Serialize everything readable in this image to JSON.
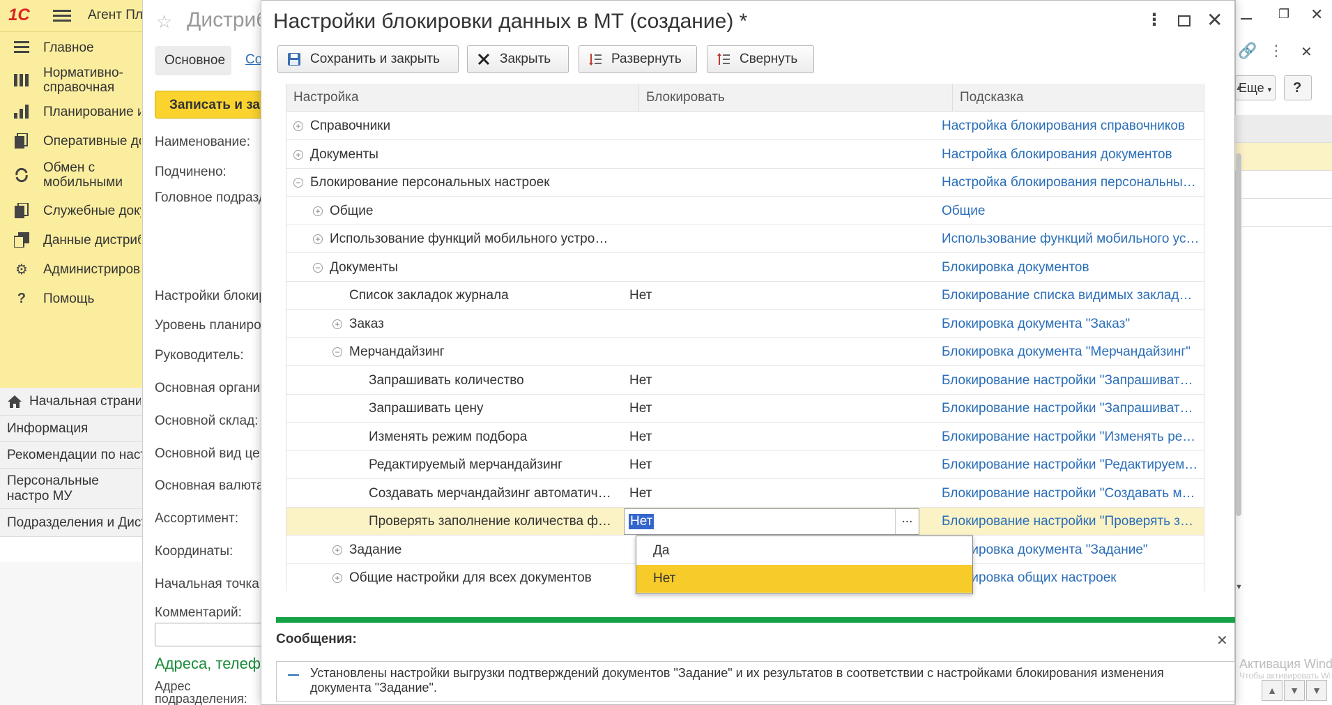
{
  "app": {
    "logo": "1С",
    "title": "Агент Пл"
  },
  "sidebar": {
    "items": [
      {
        "label": "Главное",
        "icon": "list-icon"
      },
      {
        "label": "Нормативно-справочная информация",
        "icon": "reference-icon"
      },
      {
        "label": "Планирование и",
        "icon": "planning-icon"
      },
      {
        "label": "Оперативные до",
        "icon": "operations-icon"
      },
      {
        "label": "Обмен с мобильными устройствами",
        "icon": "exchange-icon"
      },
      {
        "label": "Служебные доку",
        "icon": "service-docs-icon"
      },
      {
        "label": "Данные дистриб",
        "icon": "distributor-data-icon"
      },
      {
        "label": "Администрирова",
        "icon": "gear-icon"
      },
      {
        "label": "Помощь",
        "icon": "help-icon"
      }
    ],
    "start_page": "Начальная страни",
    "open_items": [
      "Информация",
      "Рекомендации по наст",
      "Персональные настро МУ",
      "Подразделения и Дист"
    ]
  },
  "background_form": {
    "title": "Дистриб",
    "tab_main": "Основное",
    "tab_link": "Со",
    "write_button": "Записать и за",
    "labels": [
      "Наименование:",
      "Подчинено:",
      "Головное подразд",
      "Настройки блокир",
      "Уровень планиро",
      "Руководитель:",
      "Основная органи",
      "Основной склад:",
      "Основной вид це",
      "Основная валюта",
      "Ассортимент:",
      "Координаты:",
      "Начальная точка",
      "Комментарий:"
    ],
    "section": "Адреса, телеф",
    "address_label": "Адрес подразделения:"
  },
  "right_panel": {
    "more_dropdown": "Еще",
    "help_button": "?"
  },
  "dialog": {
    "title": "Настройки блокировки данных в МТ (создание) *",
    "toolbar": {
      "save_close": "Сохранить и закрыть",
      "close": "Закрыть",
      "expand": "Развернуть",
      "collapse": "Свернуть"
    },
    "table": {
      "headers": {
        "setting": "Настройка",
        "block": "Блокировать",
        "hint": "Подсказка"
      },
      "rows": [
        {
          "name": "Справочники",
          "value": "",
          "hint": "Настройка блокирования справочников",
          "level": 0,
          "toggle": "⊕"
        },
        {
          "name": "Документы",
          "value": "",
          "hint": "Настройка блокирования документов",
          "level": 0,
          "toggle": "⊕"
        },
        {
          "name": "Блокирование персональных настроек",
          "value": "",
          "hint": "Настройка блокирования персональных настроек",
          "level": 0,
          "toggle": "⊖"
        },
        {
          "name": "Общие",
          "value": "",
          "hint": "Общие",
          "level": 1,
          "toggle": "⊕"
        },
        {
          "name": "Использование функций мобильного устройства",
          "value": "",
          "hint": "Использование функций мобильного устройства",
          "level": 1,
          "toggle": "⊕"
        },
        {
          "name": "Документы",
          "value": "",
          "hint": "Блокировка документов",
          "level": 1,
          "toggle": "⊖"
        },
        {
          "name": "Список закладок журнала",
          "value": "Нет",
          "hint": "Блокирование списка видимых закладок журнала",
          "level": 2,
          "toggle": ""
        },
        {
          "name": "Заказ",
          "value": "",
          "hint": "Блокировка документа \"Заказ\"",
          "level": 2,
          "toggle": "⊕"
        },
        {
          "name": "Мерчандайзинг",
          "value": "",
          "hint": "Блокировка документа \"Мерчандайзинг\"",
          "level": 2,
          "toggle": "⊖"
        },
        {
          "name": "Запрашивать количество",
          "value": "Нет",
          "hint": "Блокирование настройки \"Запрашивать количество\"",
          "level": 3,
          "toggle": ""
        },
        {
          "name": "Запрашивать цену",
          "value": "Нет",
          "hint": "Блокирование настройки \"Запрашивать цену\"",
          "level": 3,
          "toggle": ""
        },
        {
          "name": "Изменять режим подбора",
          "value": "Нет",
          "hint": "Блокирование настройки \"Изменять режим подбора\"",
          "level": 3,
          "toggle": ""
        },
        {
          "name": "Редактируемый мерчандайзинг",
          "value": "Нет",
          "hint": "Блокирование настройки \"Редактируемый мерчандайзинг\"",
          "level": 3,
          "toggle": ""
        },
        {
          "name": "Создавать мерчандайзинг автоматически",
          "value": "Нет",
          "hint": "Блокирование настройки \"Создавать мерчандайзинг\"",
          "level": 3,
          "toggle": ""
        },
        {
          "name": "Проверять заполнение количества фактов",
          "value": "Нет",
          "hint": "Блокирование настройки \"Проверять заполнение\"",
          "level": 3,
          "toggle": "",
          "selected": true
        },
        {
          "name": "Задание",
          "value": "",
          "hint": "Блокировка документа \"Задание\"",
          "level": 2,
          "toggle": "⊕"
        },
        {
          "name": "Общие настройки для всех документов",
          "value": "",
          "hint": "Блокировка общих настроек",
          "level": 2,
          "toggle": "⊕"
        }
      ],
      "editor_button": "..."
    },
    "dropdown_options": [
      {
        "label": "Да",
        "highlighted": false
      },
      {
        "label": "Нет",
        "highlighted": true
      }
    ],
    "messages": {
      "title": "Сообщения:",
      "text": "Установлены настройки выгрузки подтверждений документов \"Задание\" и их результатов в соответствии с настройками блокирования изменения документа \"Задание\"."
    }
  },
  "watermark": {
    "line1": "Активация Windows",
    "line2": "Чтобы активировать Windows, перейдите в раздел \"Параметры\"."
  },
  "colors": {
    "sidebar_bg": "#fbed9e",
    "accent_yellow": "#f7cb2a",
    "link_blue": "#2a6eb8",
    "messages_green": "#15a246",
    "selected_row": "#fbf2c6"
  }
}
